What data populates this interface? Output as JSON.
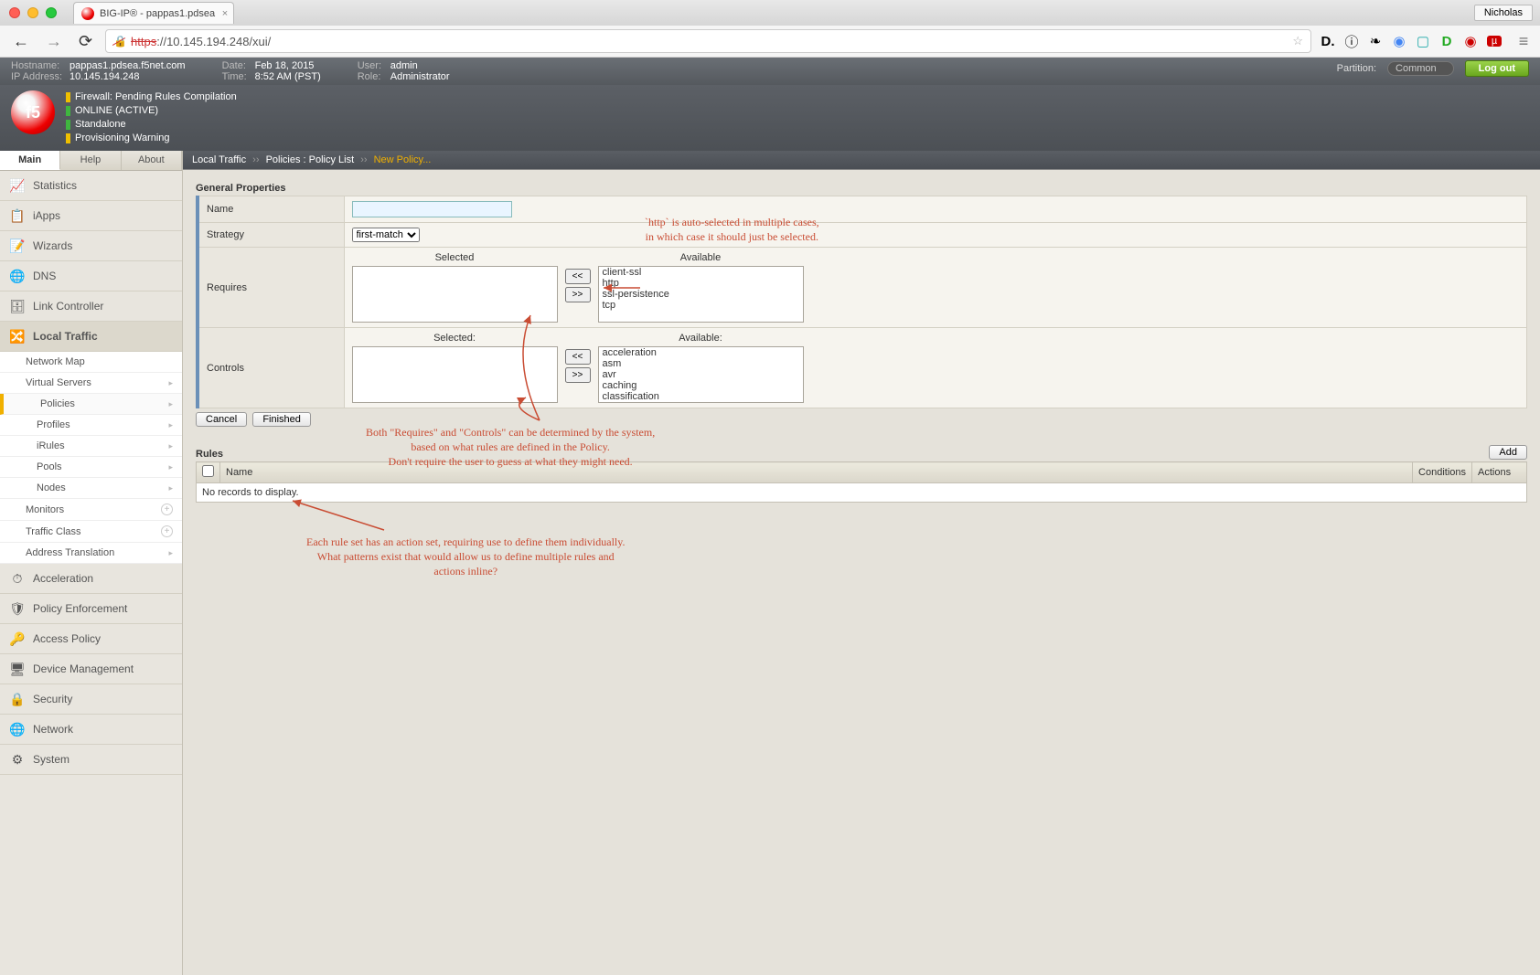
{
  "browser": {
    "tab_title": "BIG-IP® - pappas1.pdsea",
    "profile": "Nicholas",
    "url_proto": "https",
    "url_rest": "://10.145.194.248/xui/"
  },
  "header": {
    "hostname_lbl": "Hostname:",
    "hostname": "pappas1.pdsea.f5net.com",
    "ip_lbl": "IP Address:",
    "ip": "10.145.194.248",
    "date_lbl": "Date:",
    "date": "Feb 18, 2015",
    "time_lbl": "Time:",
    "time": "8:52 AM (PST)",
    "user_lbl": "User:",
    "user": "admin",
    "role_lbl": "Role:",
    "role": "Administrator",
    "partition_lbl": "Partition:",
    "partition": "Common",
    "logout": "Log out"
  },
  "status": {
    "l1": "Firewall: Pending Rules Compilation",
    "l2": "ONLINE (ACTIVE)",
    "l3": "Standalone",
    "l4": "Provisioning Warning"
  },
  "tabs": {
    "main": "Main",
    "help": "Help",
    "about": "About"
  },
  "nav": {
    "statistics": "Statistics",
    "iapps": "iApps",
    "wizards": "Wizards",
    "dns": "DNS",
    "link_controller": "Link Controller",
    "local_traffic": "Local Traffic",
    "acceleration": "Acceleration",
    "policy_enforcement": "Policy Enforcement",
    "access_policy": "Access Policy",
    "device_management": "Device Management",
    "security": "Security",
    "network": "Network",
    "system": "System"
  },
  "subnav": {
    "network_map": "Network Map",
    "virtual_servers": "Virtual Servers",
    "policies": "Policies",
    "profiles": "Profiles",
    "irules": "iRules",
    "pools": "Pools",
    "nodes": "Nodes",
    "monitors": "Monitors",
    "traffic_class": "Traffic Class",
    "address_translation": "Address Translation"
  },
  "breadcrumb": {
    "a": "Local Traffic",
    "b": "Policies : Policy List",
    "c": "New Policy..."
  },
  "form": {
    "section": "General Properties",
    "name_lbl": "Name",
    "strategy_lbl": "Strategy",
    "strategy_val": "first-match",
    "requires_lbl": "Requires",
    "controls_lbl": "Controls",
    "selected_hdr": "Selected",
    "available_hdr": "Available",
    "selected_hdr2": "Selected:",
    "available_hdr2": "Available:",
    "requires_available": [
      "client-ssl",
      "http",
      "ssl-persistence",
      "tcp"
    ],
    "controls_available": [
      "acceleration",
      "asm",
      "avr",
      "caching",
      "classification"
    ],
    "move_in": "<<",
    "move_out": ">>",
    "cancel": "Cancel",
    "finished": "Finished"
  },
  "rules": {
    "title": "Rules",
    "add": "Add",
    "col_name": "Name",
    "col_cond": "Conditions",
    "col_act": "Actions",
    "empty": "No records to display."
  },
  "annotations": {
    "a1": "`http` is auto-selected in multiple cases,\nin which case it should just be selected.",
    "a2": "Both \"Requires\" and \"Controls\" can be determined by the system,\nbased on what rules are defined in the Policy.\nDon't require the user to guess at what they might need.",
    "a3": "Each rule set has an action set, requiring use to define them individually.\nWhat patterns exist that would allow us to define multiple rules and\nactions inline?"
  }
}
